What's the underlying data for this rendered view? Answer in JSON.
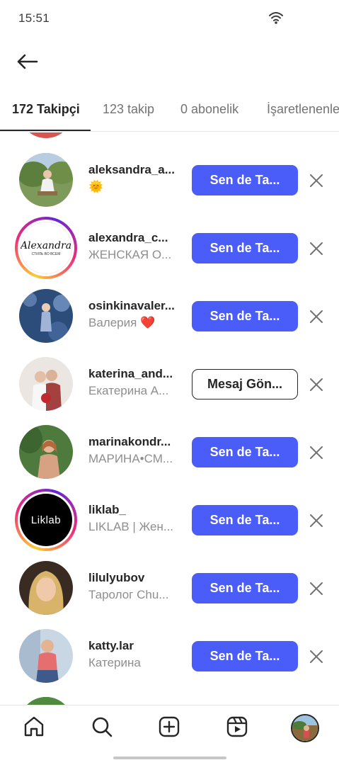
{
  "status_bar": {
    "time": "15:51"
  },
  "tabs": [
    {
      "label": "172 Takipçi"
    },
    {
      "label": "123 takip"
    },
    {
      "label": "0 abonelik"
    },
    {
      "label": "İşaretlenenler"
    }
  ],
  "followers": [
    {
      "username": "aleksandra_a...",
      "fullname": "🌞",
      "button": "Sen de Ta..."
    },
    {
      "username": "alexandra_c...",
      "fullname": "ЖЕНСКАЯ О...",
      "button": "Sen de Ta...",
      "logo_text": "Alexandra",
      "logo_sub": "СТИЛЬ ВО ВСЕМ"
    },
    {
      "username": "osinkinavaler...",
      "fullname": "Валерия ❤️",
      "button": "Sen de Ta..."
    },
    {
      "username": "katerina_and...",
      "fullname": "Екатерина А...",
      "button": "Mesaj Gön..."
    },
    {
      "username": "marinakondr...",
      "fullname": "МАРИНА•СМ...",
      "button": "Sen de Ta..."
    },
    {
      "username": "liklab_",
      "fullname": "LIKLAB | Жен...",
      "button": "Sen de Ta...",
      "logo_text": "Liklab"
    },
    {
      "username": "lilulyubov",
      "fullname": "Таролог Chu...",
      "button": "Sen de Ta..."
    },
    {
      "username": "katty.lar",
      "fullname": "Катерина",
      "button": "Sen de Ta..."
    }
  ],
  "colors": {
    "follow_button": "#4a5df9",
    "text_primary": "#262626",
    "text_secondary": "#8e8e8e"
  },
  "icons": {
    "back": "arrow-left-icon",
    "remove": "close-icon",
    "nav": [
      "home-icon",
      "search-icon",
      "create-icon",
      "reels-icon",
      "profile-avatar"
    ]
  }
}
